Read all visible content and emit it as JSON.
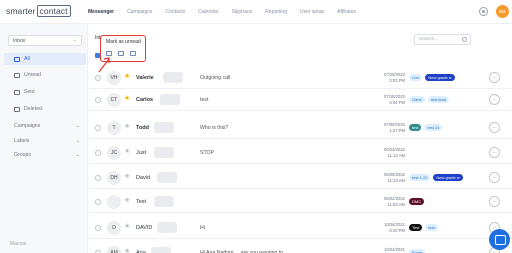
{
  "logo": {
    "text_a": "smarter",
    "text_b": "contact"
  },
  "nav": [
    "Messenger",
    "Campaigns",
    "Contacts",
    "Calendar",
    "Skiptrace",
    "Reporting",
    "User setup",
    "Affiliates"
  ],
  "user": {
    "initials": "DA"
  },
  "sidebar": {
    "inbox_select": "Inbox",
    "items": [
      {
        "label": "All",
        "active": true
      },
      {
        "label": "Unread"
      },
      {
        "label": "Sent"
      },
      {
        "label": "Deleted"
      }
    ],
    "sections": [
      "Campaigns",
      "Labels",
      "Groups"
    ],
    "footer": "Macros"
  },
  "list": {
    "heading": "Inb",
    "search_placeholder": "Search...",
    "popup_label": "Mark as unread"
  },
  "rows": [
    {
      "initials": "VH",
      "starred": true,
      "name": "Valerie",
      "bold": true,
      "message": "Outgoing call",
      "date": "07/25/2022",
      "time": "3:02 PM",
      "tags": [
        {
          "text": "Live",
          "style": "light"
        },
        {
          "text": "New grade w",
          "style": "dark"
        }
      ]
    },
    {
      "initials": "CT",
      "starred": true,
      "name": "Carlos",
      "bold": true,
      "message": "test",
      "date": "07/15/2022",
      "time": "5:04 PM",
      "tags": [
        {
          "text": "Gahe",
          "style": "light"
        },
        {
          "text": "test lead",
          "style": "light"
        }
      ]
    },
    {
      "initials": "T",
      "starred": false,
      "name": "Todd",
      "bold": true,
      "message": "Who is this?",
      "date": "07/06/2022",
      "time": "1:27 PM",
      "tags": [
        {
          "text": "test",
          "style": "teal"
        },
        {
          "text": "test 24",
          "style": "light"
        }
      ]
    },
    {
      "initials": "JC",
      "starred": false,
      "name": "Just",
      "bold": false,
      "message": "STOP",
      "date": "06/24/2022",
      "time": "11:12 AM",
      "tags": []
    },
    {
      "initials": "DH",
      "starred": false,
      "name": "David",
      "bold": false,
      "message": "",
      "date": "06/06/2022",
      "time": "11:23 AM",
      "tags": [
        {
          "text": "test 1.22",
          "style": "light"
        },
        {
          "text": "New grade w",
          "style": "dark"
        }
      ]
    },
    {
      "initials": "",
      "starred": false,
      "name": "Test",
      "bold": false,
      "message": "",
      "date": "06/02/2022",
      "time": "11:53 AM",
      "tags": [
        {
          "text": "DMC",
          "style": "maroon"
        }
      ]
    },
    {
      "initials": "D",
      "starred": false,
      "name": "DAVID",
      "bold": false,
      "message": "Hi",
      "date": "10/26/2021",
      "time": "8:43 PM",
      "tags": [
        {
          "text": "Test",
          "style": "black"
        },
        {
          "text": "test",
          "style": "light"
        }
      ]
    },
    {
      "initials": "AM",
      "starred": false,
      "name": "Ana",
      "bold": false,
      "message": "Hi Ana Nathan ... are you wanting to",
      "date": "10/24/2021",
      "time": "",
      "tags": [
        {
          "text": "Buyer",
          "style": "light"
        }
      ]
    }
  ]
}
